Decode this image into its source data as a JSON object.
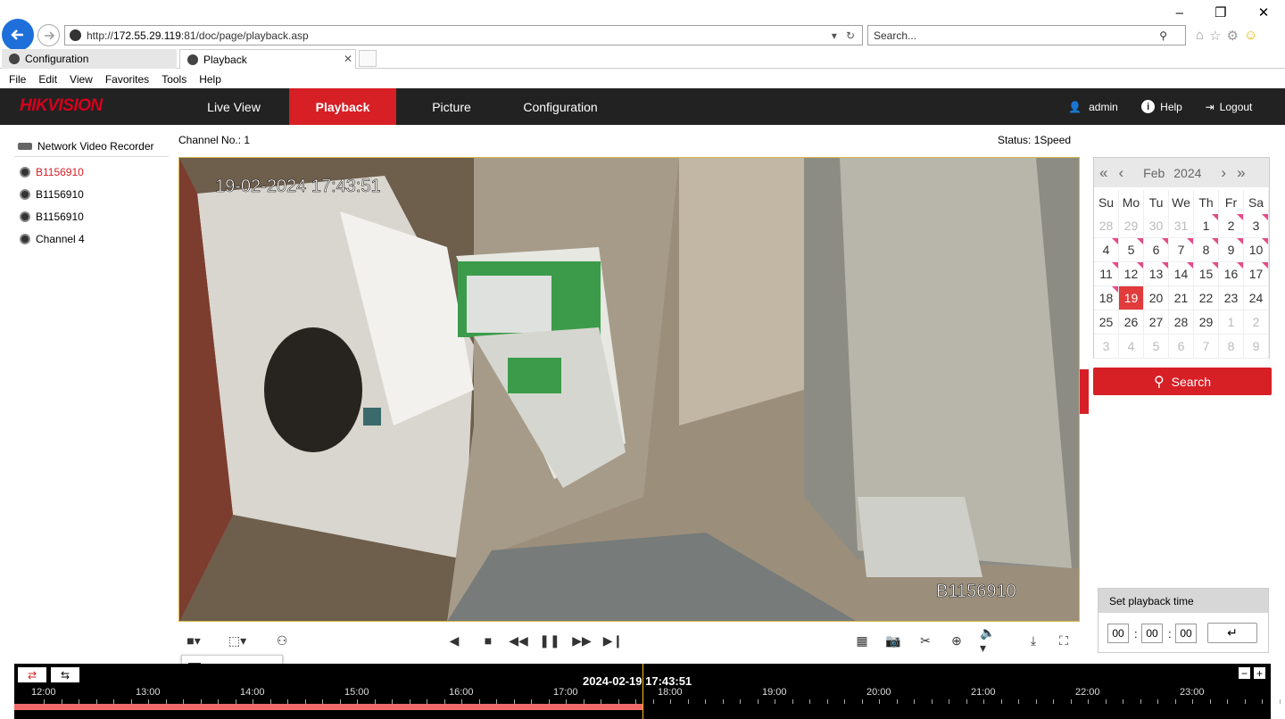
{
  "browser": {
    "url_prefix": "http://",
    "url_host": "172.55.29.119",
    "url_rest": ":81/doc/page/playback.asp",
    "search_placeholder": "Search...",
    "tabs": [
      {
        "label": "Configuration"
      },
      {
        "label": "Playback"
      }
    ],
    "menu": [
      "File",
      "Edit",
      "View",
      "Favorites",
      "Tools",
      "Help"
    ]
  },
  "app": {
    "logo": "HIKVISION",
    "nav": [
      {
        "label": "Live View"
      },
      {
        "label": "Playback",
        "active": true
      },
      {
        "label": "Picture"
      },
      {
        "label": "Configuration"
      }
    ],
    "user": "admin",
    "help": "Help",
    "logout": "Logout"
  },
  "sidebar": {
    "device": "Network Video Recorder",
    "channels": [
      {
        "label": "B1156910",
        "selected": true
      },
      {
        "label": "B1156910"
      },
      {
        "label": "B1156910"
      },
      {
        "label": "Channel 4"
      }
    ]
  },
  "player": {
    "channel_label": "Channel No.: 1",
    "status_label": "Status: 1Speed",
    "osd_time": "19-02-2024 17:43:51",
    "osd_name": "B1156910"
  },
  "calendar": {
    "month": "Feb",
    "year": "2024",
    "weekdays": [
      "Su",
      "Mo",
      "Tu",
      "We",
      "Th",
      "Fr",
      "Sa"
    ],
    "weeks": [
      [
        {
          "d": "28",
          "dim": true
        },
        {
          "d": "29",
          "dim": true
        },
        {
          "d": "30",
          "dim": true
        },
        {
          "d": "31",
          "dim": true
        },
        {
          "d": "1",
          "rec": true
        },
        {
          "d": "2",
          "rec": true
        },
        {
          "d": "3",
          "rec": true
        }
      ],
      [
        {
          "d": "4",
          "rec": true
        },
        {
          "d": "5",
          "rec": true
        },
        {
          "d": "6",
          "rec": true
        },
        {
          "d": "7",
          "rec": true
        },
        {
          "d": "8",
          "rec": true
        },
        {
          "d": "9",
          "rec": true
        },
        {
          "d": "10",
          "rec": true
        }
      ],
      [
        {
          "d": "11",
          "rec": true
        },
        {
          "d": "12",
          "rec": true
        },
        {
          "d": "13",
          "rec": true
        },
        {
          "d": "14",
          "rec": true
        },
        {
          "d": "15",
          "rec": true
        },
        {
          "d": "16",
          "rec": true
        },
        {
          "d": "17",
          "rec": true
        }
      ],
      [
        {
          "d": "18",
          "rec": true
        },
        {
          "d": "19",
          "sel": true
        },
        {
          "d": "20"
        },
        {
          "d": "21"
        },
        {
          "d": "22"
        },
        {
          "d": "23"
        },
        {
          "d": "24"
        }
      ],
      [
        {
          "d": "25"
        },
        {
          "d": "26"
        },
        {
          "d": "27"
        },
        {
          "d": "28"
        },
        {
          "d": "29"
        },
        {
          "d": "1",
          "dim": true
        },
        {
          "d": "2",
          "dim": true
        }
      ],
      [
        {
          "d": "3",
          "dim": true
        },
        {
          "d": "4",
          "dim": true
        },
        {
          "d": "5",
          "dim": true
        },
        {
          "d": "6",
          "dim": true
        },
        {
          "d": "7",
          "dim": true
        },
        {
          "d": "8",
          "dim": true
        },
        {
          "d": "9",
          "dim": true
        }
      ]
    ],
    "search_label": "Search"
  },
  "playback_time": {
    "title": "Set playback time",
    "hh": "00",
    "mm": "00",
    "ss": "00"
  },
  "timeline": {
    "current": "2024-02-19 17:43:51",
    "hours": [
      "12:00",
      "13:00",
      "14:00",
      "15:00",
      "16:00",
      "17:00",
      "18:00",
      "19:00",
      "20:00",
      "21:00",
      "22:00",
      "23:00"
    ],
    "colors": {
      "record": "#f06a6a",
      "cursor": "#f5c518"
    }
  }
}
